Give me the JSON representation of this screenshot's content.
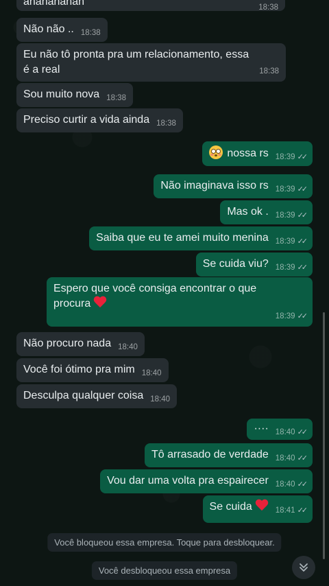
{
  "colors": {
    "incoming_bubble": "#262d31",
    "outgoing_bubble": "#0a5c43",
    "background": "#0d1613",
    "system_bubble": "#1d2428"
  },
  "messages": [
    {
      "text": "ananananan",
      "time": "18:38"
    },
    {
      "text": "Não não ..",
      "time": "18:38"
    },
    {
      "text": "Eu não tô pronta pra um relacionamento, essa\né a real",
      "time": "18:38"
    },
    {
      "text": "Sou muito nova",
      "time": "18:38"
    },
    {
      "text": "Preciso curtir a vida ainda",
      "time": "18:38"
    },
    {
      "text": "nossa rs",
      "time": "18:39",
      "emoji": "flushed-face"
    },
    {
      "text": "Não imaginava isso rs",
      "time": "18:39"
    },
    {
      "text": "Mas ok .",
      "time": "18:39"
    },
    {
      "text": "Saiba que eu te amei muito menina",
      "time": "18:39"
    },
    {
      "text": "Se cuida viu?",
      "time": "18:39"
    },
    {
      "text": "Espero que você consiga encontrar o que\nprocura",
      "time": "18:39",
      "emoji": "red-heart"
    },
    {
      "text": "Não procuro nada",
      "time": "18:40"
    },
    {
      "text": "Você foi ótimo pra mim",
      "time": "18:40"
    },
    {
      "text": "Desculpa qualquer coisa",
      "time": "18:40"
    },
    {
      "text": "····",
      "time": "18:40"
    },
    {
      "text": "Tô arrasado de verdade",
      "time": "18:40"
    },
    {
      "text": "Vou dar uma volta pra espairecer",
      "time": "18:40"
    },
    {
      "text": "Se cuida",
      "time": "18:41",
      "emoji": "red-heart"
    }
  ],
  "system": {
    "blocked": "Você bloqueou essa empresa. Toque para desbloquear.",
    "unblocked": "Você desbloqueou essa empresa"
  },
  "icons": {
    "read_ticks": "double-check-icon",
    "scroll_down": "chevrons-down-icon"
  }
}
